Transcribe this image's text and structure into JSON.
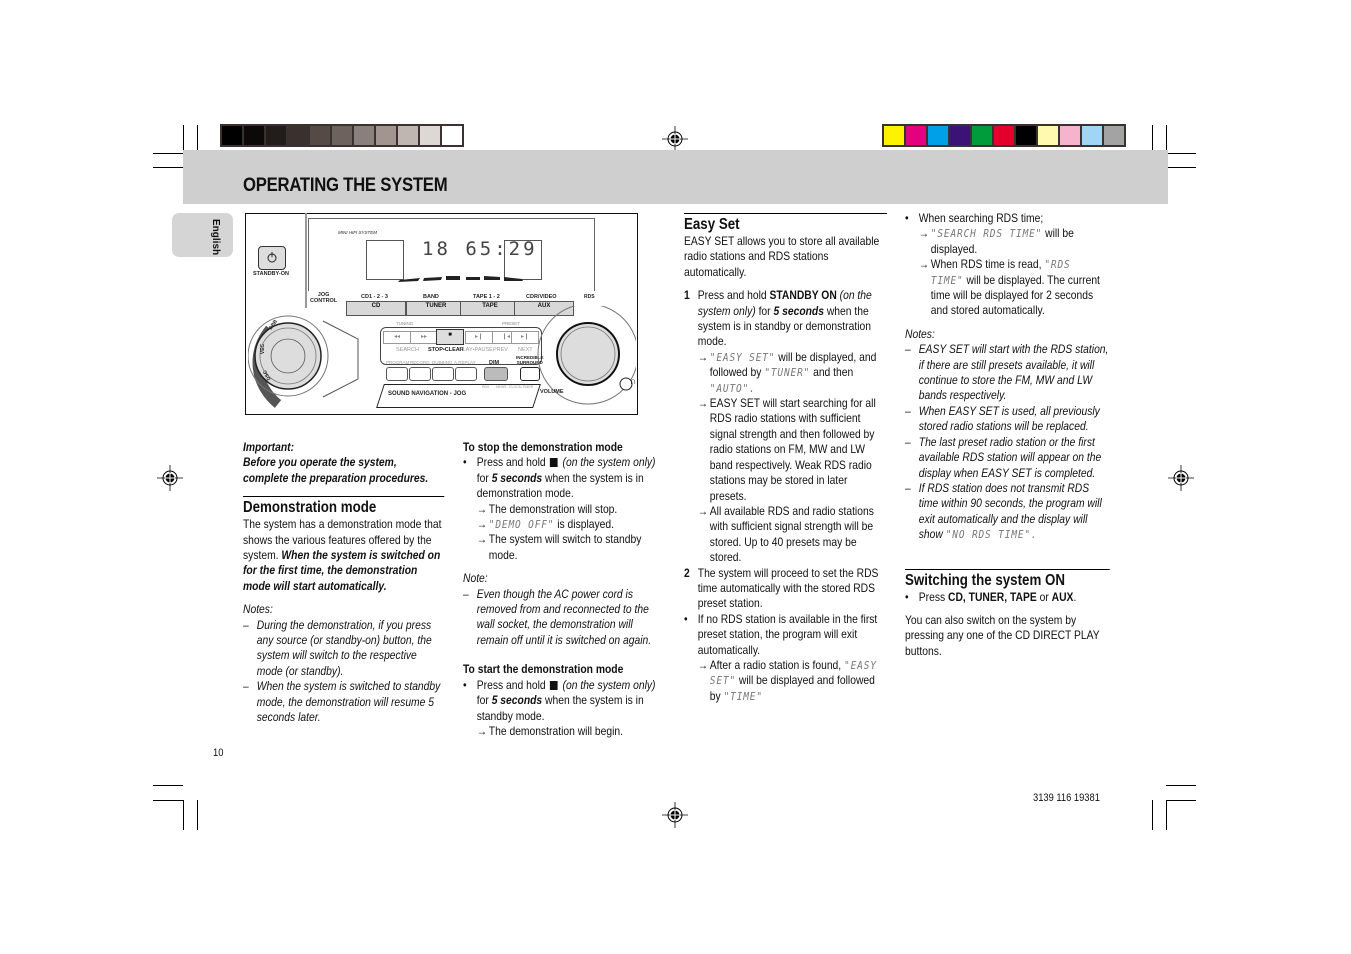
{
  "color_bars": {
    "grayscale": [
      "#000000",
      "#0d0909",
      "#221c1a",
      "#3a302d",
      "#554a46",
      "#6d625e",
      "#8b7f7b",
      "#a2958f",
      "#c0b6b1",
      "#ddd8d4",
      "#ffffff"
    ],
    "process": [
      "#fff200",
      "#e4007f",
      "#00a0e9",
      "#3b1377",
      "#009c3b",
      "#e4002b",
      "#000000",
      "#fff9b0",
      "#f7b3cc",
      "#a0d5f5",
      "#a3a3a3"
    ]
  },
  "header": {
    "title": "OPERATING THE SYSTEM",
    "language_tab": "English"
  },
  "device": {
    "product_label": "MINI HIFI SYSTEM",
    "display_digits": "18 65:29",
    "standby_label": "STANDBY-ON",
    "jog_label": [
      "JOG",
      "CONTROL"
    ],
    "source_headers": [
      "CD1 - 2 - 3",
      "BAND",
      "TAPE 1 - 2",
      "CDR/VIDEO"
    ],
    "source_buttons": [
      "CD",
      "TUNER",
      "TAPE",
      "AUX"
    ],
    "rds_logo": "RDS",
    "tuning_label": "TUNING",
    "preset_label": "PRESET",
    "transport_labels": [
      "SEARCH",
      "STOP•CLEAR",
      "PLAY•PAUSE",
      "PREV",
      "NEXT"
    ],
    "transport_glyphs": [
      "◂◂",
      "▸▸",
      "■",
      "▸❙",
      "❙◂",
      "▸❙"
    ],
    "function_labels": [
      "PROGRAM",
      "RECORD",
      "DUBBING",
      "A.REPLAY"
    ],
    "dim_label": "DIM",
    "surround_label": [
      "INCREDIBLE",
      "SURROUND"
    ],
    "sound_nav_label": "SOUND NAVIGATION - JOG",
    "knob_labels": [
      "RDS",
      "NEWS",
      "CLOCK•TIMER"
    ],
    "volume_label": "VOLUME",
    "jog_ring_labels": [
      "DBB",
      "VEC",
      "DSC"
    ]
  },
  "left_column": {
    "important_label": "Important:",
    "important_text": "Before you operate the system, complete the preparation procedures.",
    "demo_heading": "Demonstration mode",
    "demo_intro": "The system has a demonstration mode that shows the various features offered by the system.",
    "demo_intro_bold": "When the system is switched on for the first time, the demonstration mode will start automatically.",
    "notes_label": "Notes:",
    "notes": [
      "During the demonstration, if you press any source (or standby-on) button, the system will switch to the respective mode (or standby).",
      "When the system is switched to standby mode, the demonstration will resume 5 seconds later."
    ]
  },
  "middle_column": {
    "stop_heading": "To stop the demonstration mode",
    "stop_bullet_pre": "Press and hold",
    "stop_bullet_ital": "(on the system only)",
    "stop_bullet_for": "for",
    "stop_bullet_bold": "5 seconds",
    "stop_bullet_post": "when the system is in demonstration mode.",
    "stop_results": [
      "The demonstration will stop.",
      "is displayed.",
      "The system will switch to standby mode."
    ],
    "demo_off_lcd": "\"DEMO OFF\"",
    "note_label": "Note:",
    "note_text": "Even though the AC power cord is removed from and reconnected to the wall socket, the demonstration will remain off until it is switched on again.",
    "start_heading": "To start the demonstration mode",
    "start_bullet_pre": "Press and hold",
    "start_bullet_ital": "(on the system only)",
    "start_bullet_for": "for",
    "start_bullet_bold": "5 seconds",
    "start_bullet_post": "when the system is in standby mode.",
    "start_result": "The demonstration will begin."
  },
  "easy_set": {
    "heading": "Easy Set",
    "intro": "EASY SET allows you to store all available radio stations and RDS stations automatically.",
    "step1_num": "1",
    "step1_pre": "Press and hold",
    "step1_bold": "STANDBY ON",
    "step1_ital": "(on the system only)",
    "step1_for": "for",
    "step1_bold2": "5 seconds",
    "step1_post": "when the system is in standby or demonstration mode.",
    "r1_lcd1": "\"EASY SET\"",
    "r1_mid": "will be displayed, and followed by",
    "r1_lcd2": "\"TUNER\"",
    "r1_and": "and then",
    "r1_lcd3": "\"AUTO\".",
    "r2": "EASY SET will start searching for all RDS radio stations with sufficient signal strength and then followed by radio stations on FM, MW and LW band respectively. Weak RDS radio stations may be stored in later presets.",
    "r3": "All available RDS and radio stations with sufficient signal strength will be stored. Up to 40 presets may be stored.",
    "step2_num": "2",
    "step2": "The system will proceed to set the RDS time automatically with the stored RDS preset station.",
    "bullet": "If no RDS station is available in the first preset station, the program will exit automatically.",
    "r4_pre": "After a radio station is found,",
    "r4_lcd1": "\"EASY SET\"",
    "r4_mid": "will be displayed and followed by",
    "r4_lcd2": "\"TIME\""
  },
  "right_column": {
    "bullet": "When searching RDS time;",
    "r1_lcd": "\"SEARCH RDS TIME\"",
    "r1_post": "will be displayed.",
    "r2_pre": "When RDS time is read,",
    "r2_lcd": "\"RDS TIME\"",
    "r2_post": "will be displayed. The current time will be displayed for 2 seconds and stored automatically.",
    "notes_label": "Notes:",
    "notes": [
      "EASY SET will start with the RDS station, if there are still presets available, it will continue to store the FM, MW and LW bands respectively.",
      "When EASY SET is used, all previously stored radio stations will be replaced.",
      "The last preset radio station or the first available RDS station will appear on the display when EASY SET is completed."
    ],
    "note4_pre": "If RDS station does not transmit RDS time within 90 seconds, the program will exit automatically and the display will show",
    "note4_lcd": "\"NO RDS TIME\".",
    "switch_heading": "Switching the system ON",
    "switch_pre": "Press",
    "switch_bold": "CD, TUNER, TAPE",
    "switch_or": "or",
    "switch_bold2": "AUX",
    "switch_end": ".",
    "switch_text": "You can also switch on the system by pressing any one of the CD DIRECT PLAY buttons."
  },
  "footer": {
    "page_number": "10",
    "doc_code": "3139 116 19381"
  },
  "glyphs": {
    "bullet": "•",
    "dash": "–",
    "arrow": "→"
  }
}
